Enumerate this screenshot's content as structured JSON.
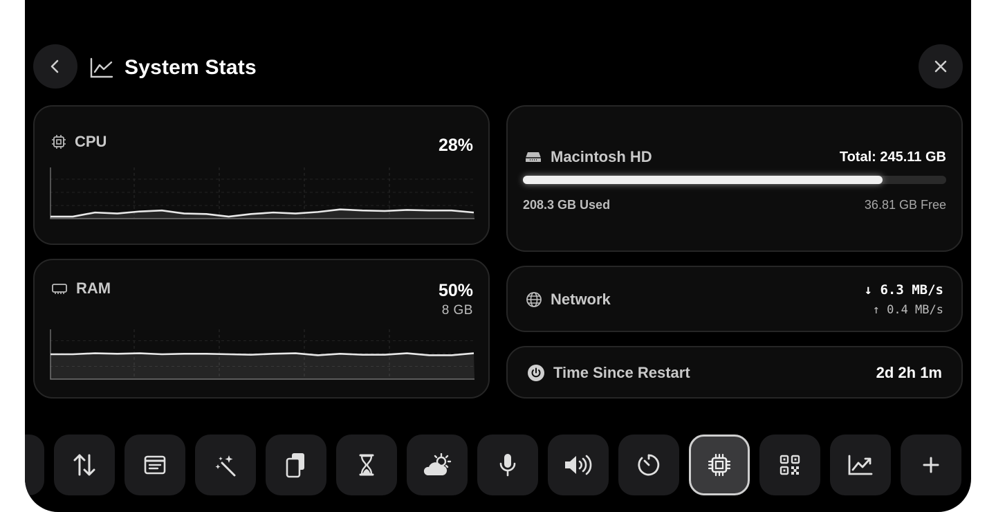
{
  "header": {
    "title": "System Stats",
    "back_icon": "chevron-left-icon",
    "title_icon": "chart-line-icon",
    "close_icon": "close-icon"
  },
  "cpu": {
    "label": "CPU",
    "value": "28%",
    "series": [
      4,
      4,
      12,
      10,
      14,
      16,
      10,
      9,
      4,
      9,
      12,
      10,
      13,
      18,
      16,
      15,
      17,
      16,
      16,
      12
    ]
  },
  "ram": {
    "label": "RAM",
    "value": "50%",
    "total": "8 GB",
    "series": [
      50,
      50,
      52,
      51,
      52,
      50,
      51,
      51,
      50,
      49,
      51,
      52,
      48,
      51,
      49,
      49,
      52,
      48,
      48,
      52
    ]
  },
  "disk": {
    "name": "Macintosh HD",
    "total": "Total: 245.11 GB",
    "used": "208.3 GB Used",
    "free": "36.81 GB Free",
    "used_fraction": 0.85
  },
  "network": {
    "label": "Network",
    "down": "↓ 6.3 MB/s",
    "up": "↑ 0.4 MB/s"
  },
  "uptime": {
    "label": "Time Since Restart",
    "value": "2d 2h 1m"
  },
  "dock": {
    "items": [
      {
        "icon": "partial-item-icon"
      },
      {
        "icon": "arrows-up-down-icon"
      },
      {
        "icon": "note-icon"
      },
      {
        "icon": "magic-wand-icon"
      },
      {
        "icon": "clipboard-icon"
      },
      {
        "icon": "hourglass-icon"
      },
      {
        "icon": "weather-icon"
      },
      {
        "icon": "microphone-icon"
      },
      {
        "icon": "volume-icon"
      },
      {
        "icon": "timer-icon"
      },
      {
        "icon": "cpu-chip-icon",
        "active": true
      },
      {
        "icon": "qr-code-icon"
      },
      {
        "icon": "chart-up-icon"
      },
      {
        "icon": "plus-icon"
      }
    ]
  },
  "colors": {
    "background": "#000000",
    "card": "#0d0d0d",
    "accent": "#ffffff"
  }
}
